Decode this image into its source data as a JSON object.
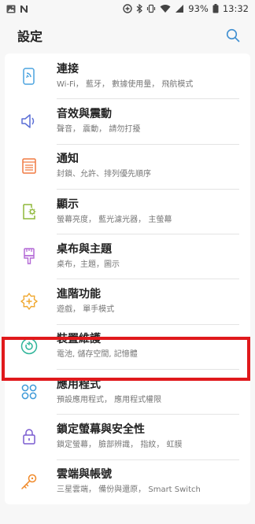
{
  "status_bar": {
    "battery": "93%",
    "time": "13:32"
  },
  "header": {
    "title": "設定"
  },
  "settings": [
    {
      "title": "連接",
      "subtitle": "Wi-Fi， 藍牙， 數據使用量， 飛航模式",
      "icon": "connections-icon",
      "color": "#4aa3df"
    },
    {
      "title": "音效與震動",
      "subtitle": "聲音， 震動， 請勿打擾",
      "icon": "sound-icon",
      "color": "#5b6fd6"
    },
    {
      "title": "通知",
      "subtitle": "封鎖、允許、排列優先順序",
      "icon": "notifications-icon",
      "color": "#f07a42"
    },
    {
      "title": "顯示",
      "subtitle": "螢幕亮度， 藍光濾光器， 主螢幕",
      "icon": "display-icon",
      "color": "#8fb83a"
    },
    {
      "title": "桌布與主題",
      "subtitle": "桌布，主題，圖示",
      "icon": "wallpaper-themes-icon",
      "color": "#b46ad6"
    },
    {
      "title": "進階功能",
      "subtitle": "遊戲， 單手模式",
      "icon": "advanced-features-icon",
      "color": "#f0a830"
    },
    {
      "title": "裝置維護",
      "subtitle": "電池, 儲存空間, 記憶體",
      "icon": "device-maintenance-icon",
      "color": "#2fb59a"
    },
    {
      "title": "應用程式",
      "subtitle": "預設應用程式， 應用程式權限",
      "icon": "apps-icon",
      "color": "#3f9ad8"
    },
    {
      "title": "鎖定螢幕與安全性",
      "subtitle": "鎖定螢幕， 臉部辨識， 指紋， 虹膜",
      "icon": "lock-screen-icon",
      "color": "#7a5bd0"
    },
    {
      "title": "雲端與帳號",
      "subtitle": "三星雲端， 備份與還原， Smart Switch",
      "icon": "cloud-accounts-icon",
      "color": "#f08a2a"
    }
  ]
}
